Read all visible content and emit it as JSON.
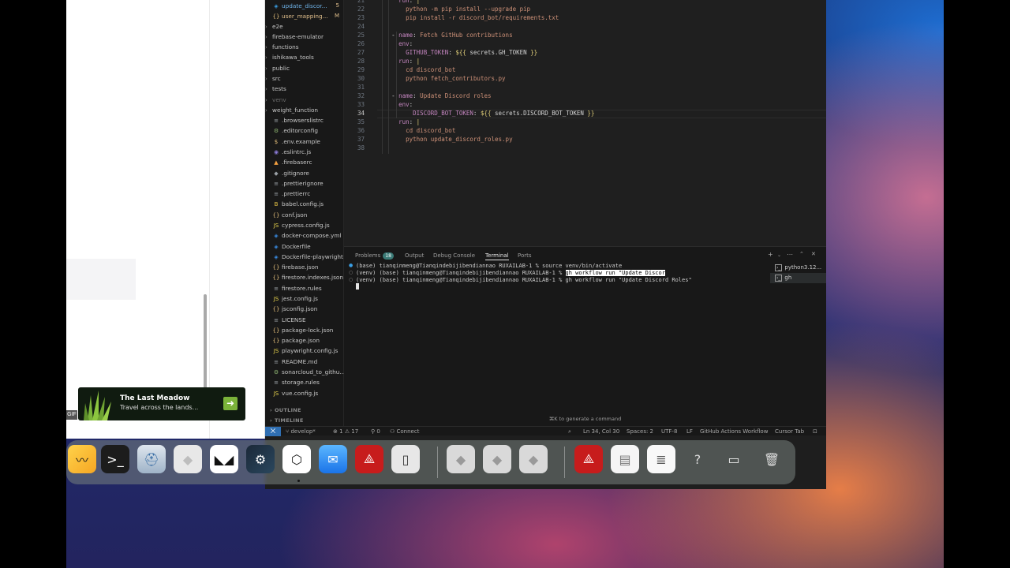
{
  "explorer": {
    "open_files": [
      {
        "label": "update_discor...",
        "badge": "5",
        "icon": "yaml-icon"
      },
      {
        "label": "user_mapping...",
        "badge": "M",
        "icon": "json-icon"
      }
    ],
    "items": [
      {
        "label": "e2e",
        "type": "folder"
      },
      {
        "label": "firebase-emulator",
        "type": "folder"
      },
      {
        "label": "functions",
        "type": "folder"
      },
      {
        "label": "ishikawa_tools",
        "type": "folder"
      },
      {
        "label": "public",
        "type": "folder"
      },
      {
        "label": "src",
        "type": "folder"
      },
      {
        "label": "tests",
        "type": "folder"
      },
      {
        "label": "venv",
        "type": "folder-dim"
      },
      {
        "label": "weight_function",
        "type": "folder"
      },
      {
        "label": ".browserslistrc",
        "type": "file",
        "icon": "≡"
      },
      {
        "label": ".editorconfig",
        "type": "file",
        "icon": "⚙"
      },
      {
        "label": ".env.example",
        "type": "file",
        "icon": "$"
      },
      {
        "label": ".eslintrc.js",
        "type": "file",
        "icon": "◉"
      },
      {
        "label": ".firebaserc",
        "type": "file",
        "icon": "▲"
      },
      {
        "label": ".gitignore",
        "type": "file",
        "icon": "◆"
      },
      {
        "label": ".prettierignore",
        "type": "file",
        "icon": "≡"
      },
      {
        "label": ".prettierrc",
        "type": "file",
        "icon": "≡"
      },
      {
        "label": "babel.config.js",
        "type": "file",
        "icon": "B"
      },
      {
        "label": "conf.json",
        "type": "file",
        "icon": "{}"
      },
      {
        "label": "cypress.config.js",
        "type": "file",
        "icon": "JS"
      },
      {
        "label": "docker-compose.yml",
        "type": "file",
        "icon": "◈"
      },
      {
        "label": "Dockerfile",
        "type": "file",
        "icon": "◈"
      },
      {
        "label": "Dockerfile-playwright",
        "type": "file",
        "icon": "◈"
      },
      {
        "label": "firebase.json",
        "type": "file",
        "icon": "{}"
      },
      {
        "label": "firestore.indexes.json",
        "type": "file",
        "icon": "{}"
      },
      {
        "label": "firestore.rules",
        "type": "file",
        "icon": "≡"
      },
      {
        "label": "jest.config.js",
        "type": "file",
        "icon": "JS"
      },
      {
        "label": "jsconfig.json",
        "type": "file",
        "icon": "{}"
      },
      {
        "label": "LICENSE",
        "type": "file",
        "icon": "≡"
      },
      {
        "label": "package-lock.json",
        "type": "file",
        "icon": "{}"
      },
      {
        "label": "package.json",
        "type": "file",
        "icon": "{}"
      },
      {
        "label": "playwright.config.js",
        "type": "file",
        "icon": "JS"
      },
      {
        "label": "README.md",
        "type": "file",
        "icon": "≡"
      },
      {
        "label": "sonarcloud_to_githu...",
        "type": "file",
        "icon": "⚙"
      },
      {
        "label": "storage.rules",
        "type": "file",
        "icon": "≡"
      },
      {
        "label": "vue.config.js",
        "type": "file",
        "icon": "JS"
      }
    ],
    "outline_label": "OUTLINE",
    "timeline_label": "TIMELINE"
  },
  "editor": {
    "current_line": "34",
    "lines": [
      {
        "n": "21",
        "t": "      run: |"
      },
      {
        "n": "22",
        "t": "        python -m pip install --upgrade pip"
      },
      {
        "n": "23",
        "t": "        pip install -r discord_bot/requirements.txt"
      },
      {
        "n": "24",
        "t": ""
      },
      {
        "n": "25",
        "t": "    - name: Fetch GitHub contributions"
      },
      {
        "n": "26",
        "t": "      env:"
      },
      {
        "n": "27",
        "t": "        GITHUB_TOKEN: ${{ secrets.GH_TOKEN }}"
      },
      {
        "n": "28",
        "t": "      run: |"
      },
      {
        "n": "29",
        "t": "        cd discord_bot"
      },
      {
        "n": "30",
        "t": "        python fetch_contributors.py"
      },
      {
        "n": "31",
        "t": ""
      },
      {
        "n": "32",
        "t": "    - name: Update Discord roles"
      },
      {
        "n": "33",
        "t": "      env:"
      },
      {
        "n": "34",
        "t": "          DISCORD_BOT_TOKEN: ${{ secrets.DISCORD_BOT_TOKEN }}"
      },
      {
        "n": "35",
        "t": "      run: |"
      },
      {
        "n": "36",
        "t": "        cd discord_bot"
      },
      {
        "n": "37",
        "t": "        python update_discord_roles.py"
      },
      {
        "n": "38",
        "t": ""
      }
    ]
  },
  "panel": {
    "tabs": {
      "problems": "Problems",
      "problems_count": "18",
      "output": "Output",
      "debug": "Debug Console",
      "terminal": "Terminal",
      "ports": "Ports"
    },
    "terminal_lines": [
      {
        "prompt": "(base) tianqinmeng@Tianqindebijibendiannao RUXAILAB-1 % ",
        "cmd": "source venv/bin/activate",
        "selected": "",
        "rest": ""
      },
      {
        "prompt": "(venv) (base) tianqinmeng@Tianqindebijibendiannao RUXAILAB-1 % ",
        "cmd": "",
        "selected": "gh workflow run \"Update Discor",
        "rest": ""
      },
      {
        "prompt": "(venv) (base) tianqinmeng@Tianqindebijibendiannao RUXAILAB-1 % ",
        "cmd": "gh workflow run \"Update Discord Roles\"",
        "selected": "",
        "rest": ""
      }
    ],
    "terminal_list": [
      "python3.12...",
      "gh"
    ],
    "hint": "⌘K to generate a command"
  },
  "statusbar": {
    "branch": "develop*",
    "errors": "⊗ 1 ⚠ 17",
    "ports": "⚲ 0",
    "connect": "Connect",
    "position": "Ln 34, Col 30",
    "spaces": "Spaces: 2",
    "encoding": "UTF-8",
    "eol": "LF",
    "language": "GitHub Actions Workflow",
    "cursor_tab": "Cursor Tab"
  },
  "ad": {
    "title": "The Last Meadow",
    "subtitle": "Travel across the lands...",
    "gif_label": "GIF"
  },
  "dock": {
    "apps": [
      "mmhmm-icon",
      "terminal-icon",
      "disk-utility-icon",
      "roblox-icon",
      "nightowl-icon",
      "steam-icon",
      "unity-icon",
      "mail-icon",
      "acrobat-icon",
      "iphone-mirroring-icon"
    ],
    "recents": [
      "roblox-icon",
      "roblox-icon",
      "roblox-icon"
    ],
    "stacks": [
      "acrobat-folder-icon",
      "documents-stack-icon",
      "document-icon",
      "unknown-icon",
      "file-stack-icon",
      "trash-icon"
    ]
  }
}
